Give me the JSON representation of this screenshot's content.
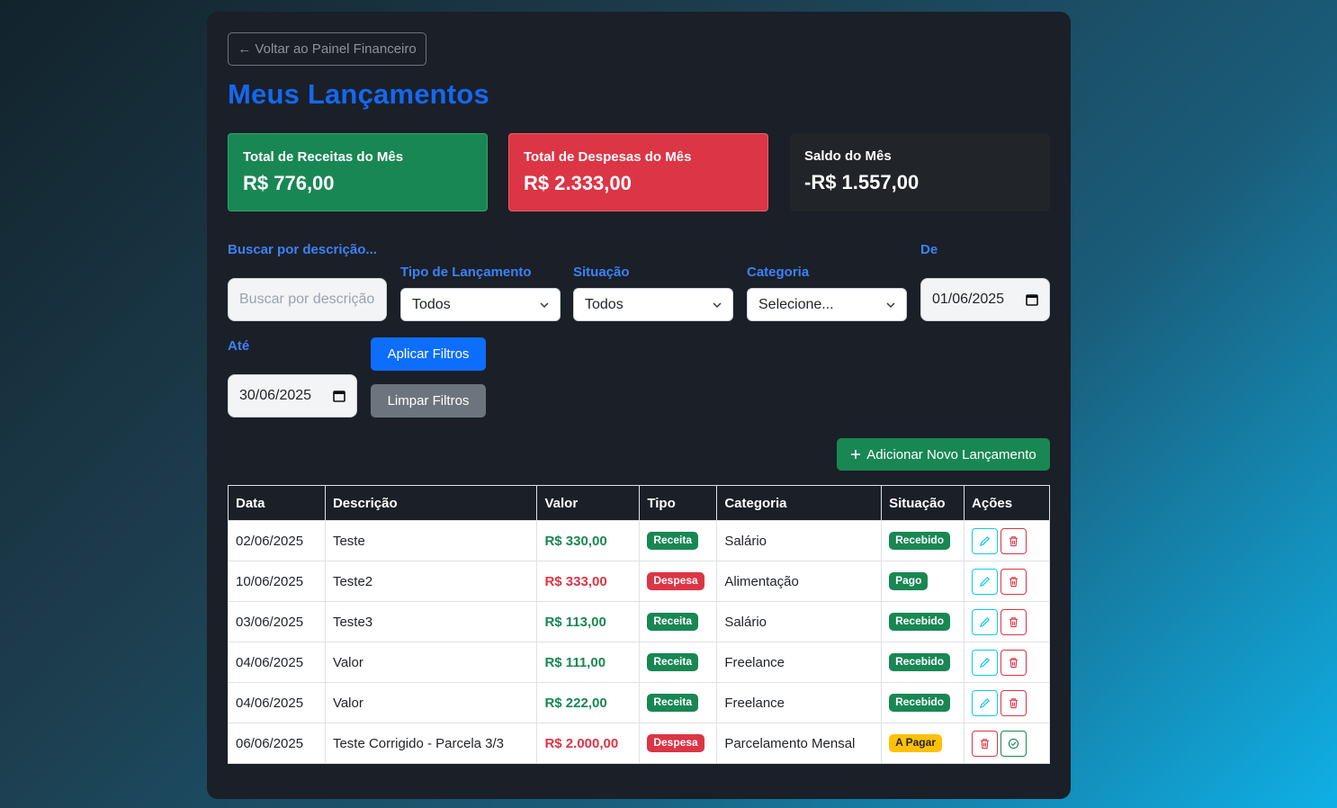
{
  "back_button": "← Voltar ao Painel Financeiro",
  "page_title": "Meus Lançamentos",
  "cards": {
    "receitas": {
      "label": "Total de Receitas do Mês",
      "value": "R$ 776,00"
    },
    "despesas": {
      "label": "Total de Despesas do Mês",
      "value": "R$ 2.333,00"
    },
    "saldo": {
      "label": "Saldo do Mês",
      "value": "-R$ 1.557,00"
    }
  },
  "filters": {
    "search_label": "Buscar por descrição...",
    "search_placeholder": "Buscar por descrição...",
    "tipo_label": "Tipo de Lançamento",
    "tipo_value": "Todos",
    "situacao_label": "Situação",
    "situacao_value": "Todos",
    "categoria_label": "Categoria",
    "categoria_value": "Selecione...",
    "de_label": "De",
    "de_value": "01/06/2025",
    "ate_label": "Até",
    "ate_value": "30/06/2025",
    "apply_label": "Aplicar Filtros",
    "clear_label": "Limpar Filtros"
  },
  "add_button": "Adicionar Novo Lançamento",
  "table": {
    "headers": [
      "Data",
      "Descrição",
      "Valor",
      "Tipo",
      "Categoria",
      "Situação",
      "Ações"
    ],
    "rows": [
      {
        "data": "02/06/2025",
        "descricao": "Teste",
        "valor": "R$ 330,00",
        "tipo": "Receita",
        "categoria": "Salário",
        "situacao": "Recebido"
      },
      {
        "data": "10/06/2025",
        "descricao": "Teste2",
        "valor": "R$ 333,00",
        "tipo": "Despesa",
        "categoria": "Alimentação",
        "situacao": "Pago"
      },
      {
        "data": "03/06/2025",
        "descricao": "Teste3",
        "valor": "R$ 113,00",
        "tipo": "Receita",
        "categoria": "Salário",
        "situacao": "Recebido"
      },
      {
        "data": "04/06/2025",
        "descricao": "Valor",
        "valor": "R$ 111,00",
        "tipo": "Receita",
        "categoria": "Freelance",
        "situacao": "Recebido"
      },
      {
        "data": "04/06/2025",
        "descricao": "Valor",
        "valor": "R$ 222,00",
        "tipo": "Receita",
        "categoria": "Freelance",
        "situacao": "Recebido"
      },
      {
        "data": "06/06/2025",
        "descricao": "Teste Corrigido - Parcela 3/3",
        "valor": "R$ 2.000,00",
        "tipo": "Despesa",
        "categoria": "Parcelamento Mensal",
        "situacao": "A Pagar"
      }
    ]
  },
  "colors": {
    "accent": "#1468f0",
    "success": "#198754",
    "danger": "#dc3545",
    "warning": "#ffc107",
    "info": "#0dcaf0"
  },
  "icons": {
    "edit": "pencil-icon",
    "delete": "trash-icon",
    "pay": "check-circle-icon",
    "add": "plus-icon",
    "select": "chevron-down-icon",
    "date": "calendar-icon"
  }
}
